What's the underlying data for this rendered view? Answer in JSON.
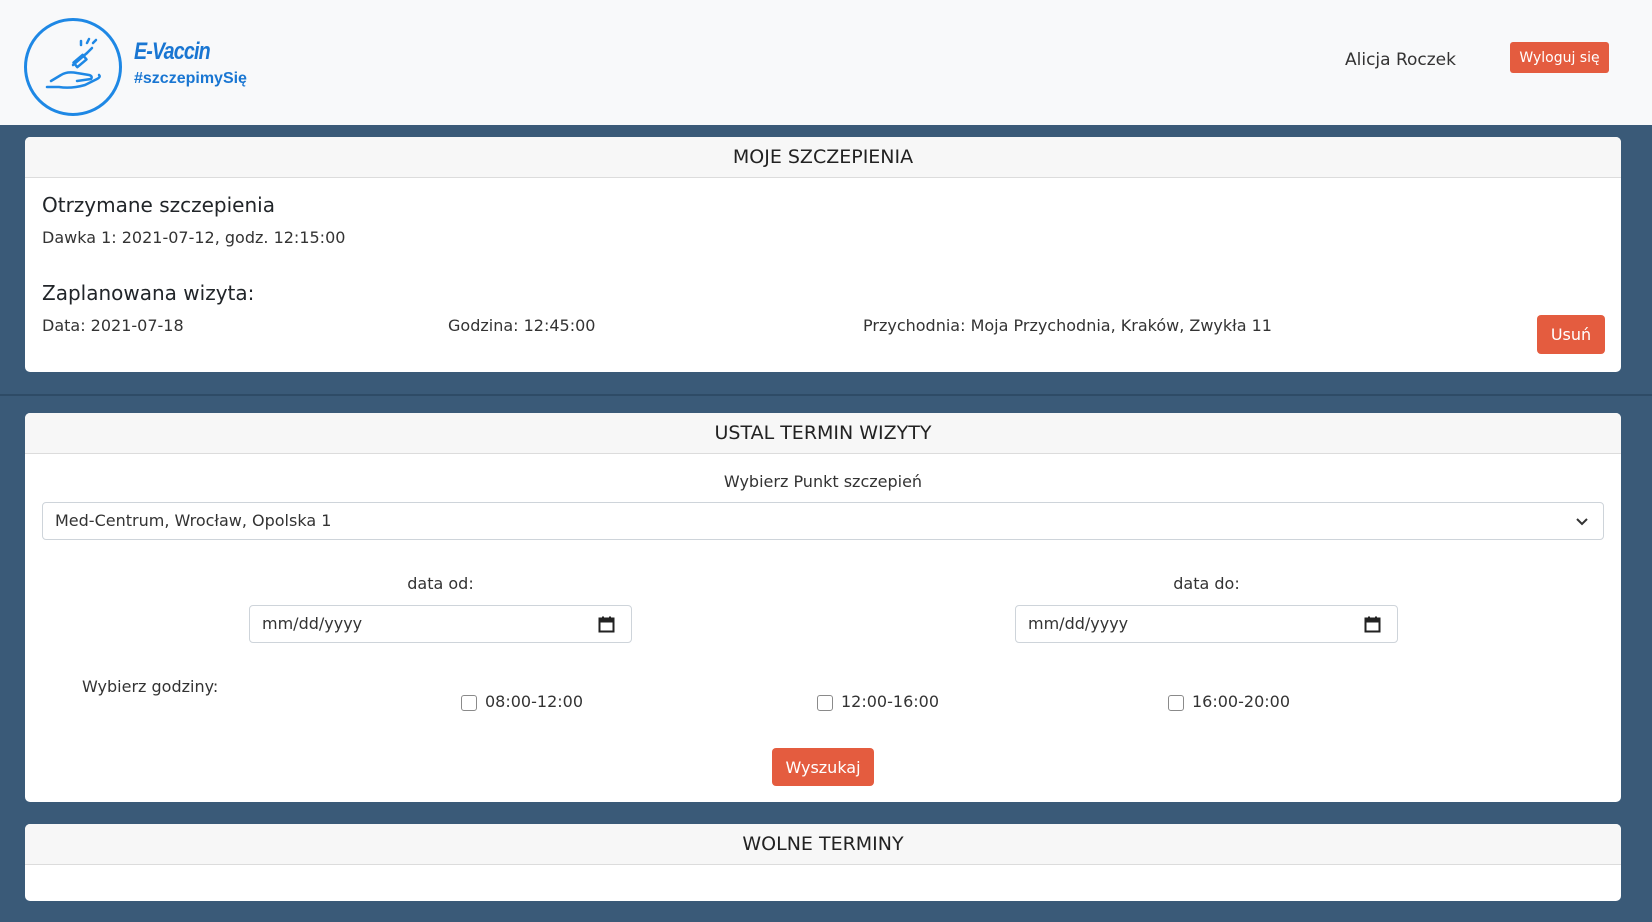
{
  "header": {
    "brand_title": "E-Vaccin",
    "brand_tag": "#szczepimySię",
    "user_name": "Alicja Roczek",
    "logout_label": "Wyloguj się"
  },
  "my_vaccinations": {
    "title": "MOJE SZCZEPIENIA",
    "received_heading": "Otrzymane szczepienia",
    "dose_1": "Dawka 1: 2021-07-12, godz. 12:15:00",
    "planned_heading": "Zaplanowana wizyta:",
    "date": "Data: 2021-07-18",
    "time": "Godzina: 12:45:00",
    "clinic": "Przychodnia: Moja Przychodnia, Kraków, Zwykła 11",
    "delete_label": "Usuń"
  },
  "schedule": {
    "title": "USTAL TERMIN WIZYTY",
    "select_label": "Wybierz Punkt szczepień",
    "selected_point": "Med-Centrum, Wrocław, Opolska 1",
    "date_from_label": "data od:",
    "date_from_placeholder": "mm/dd/yyyy",
    "date_to_label": "data do:",
    "date_to_placeholder": "mm/dd/yyyy",
    "hours_label": "Wybierz godziny:",
    "slot_1": "08:00-12:00",
    "slot_2": "12:00-16:00",
    "slot_3": "16:00-20:00",
    "search_label": "Wyszukaj"
  },
  "free_slots": {
    "title": "WOLNE TERMINY"
  },
  "colors": {
    "accent": "#e45c3f",
    "brand": "#1976d2",
    "background": "#3a5a78"
  }
}
